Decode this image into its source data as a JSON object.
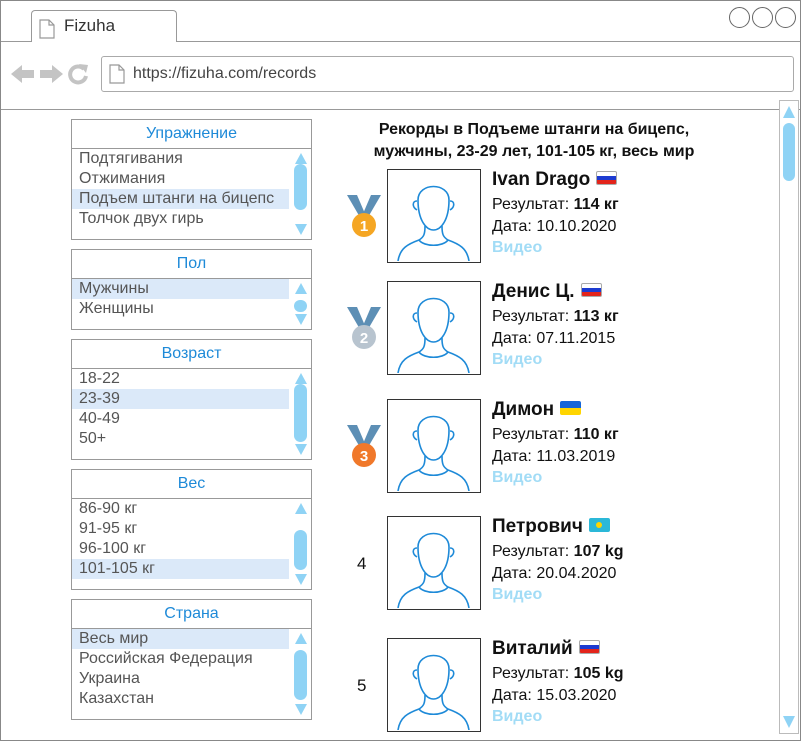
{
  "browser": {
    "tab_title": "Fizuha",
    "url": "https://fizuha.com/records"
  },
  "filters": [
    {
      "title": "Упражнение",
      "items": [
        "Подтягивания",
        "Отжимания",
        "Подъем штанги на бицепс",
        "Толчок двух гирь"
      ],
      "selected": 2
    },
    {
      "title": "Пол",
      "items": [
        "Мужчины",
        "Женщины"
      ],
      "selected": 0
    },
    {
      "title": "Возраст",
      "items": [
        "18-22",
        "23-39",
        "40-49",
        "50+"
      ],
      "selected": 1
    },
    {
      "title": "Вес",
      "items": [
        "86-90 кг",
        "91-95 кг",
        "96-100 кг",
        "101-105 кг"
      ],
      "selected": 3
    },
    {
      "title": "Страна",
      "items": [
        "Весь мир",
        "Российская Федерация",
        "Украина",
        "Казахстан"
      ],
      "selected": 0
    }
  ],
  "main": {
    "title_line1": "Рекорды в Подъеме штанги на бицепс,",
    "title_line2": "мужчины, 23-29 лет, 101-105 кг, весь мир"
  },
  "colors": {
    "accent": "#1e8ad8",
    "video_link": "#a2dcf6",
    "gold": "#f5a623",
    "silver": "#b8c4cf",
    "bronze": "#f0782a",
    "ribbon": "#5d8fb5"
  },
  "records": [
    {
      "rank": "1",
      "medal": "gold",
      "name": "Ivan Drago",
      "flag": "ru",
      "result_label": "Результат:",
      "result": "114 кг",
      "date_label": "Дата:",
      "date": "10.10.2020",
      "video": "Видео"
    },
    {
      "rank": "2",
      "medal": "silver",
      "name": "Денис Ц.",
      "flag": "ru",
      "result_label": "Результат:",
      "result": "113 кг",
      "date_label": "Дата:",
      "date": "07.11.2015",
      "video": "Видео"
    },
    {
      "rank": "3",
      "medal": "bronze",
      "name": "Димон",
      "flag": "ua",
      "result_label": "Результат:",
      "result": "110 кг",
      "date_label": "Дата:",
      "date": "11.03.2019",
      "video": "Видео"
    },
    {
      "rank": "4",
      "medal": "",
      "name": "Петрович",
      "flag": "kz",
      "result_label": "Результат:",
      "result": "107 kg",
      "date_label": "Дата:",
      "date": "20.04.2020",
      "video": "Видео"
    },
    {
      "rank": "5",
      "medal": "",
      "name": "Виталий",
      "flag": "ru",
      "result_label": "Результат:",
      "result": "105 kg",
      "date_label": "Дата:",
      "date": "15.03.2020",
      "video": "Видео"
    }
  ]
}
